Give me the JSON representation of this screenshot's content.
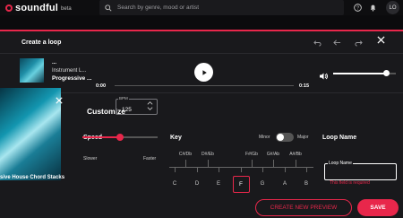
{
  "app": {
    "name": "soundful",
    "badge": "beta"
  },
  "search": {
    "placeholder": "Search by genre, mood or artist",
    "icon": "search-icon"
  },
  "user": {
    "initials": "LO"
  },
  "colors": {
    "accent": "#e8274b",
    "modal_bg": "#19191c",
    "page_bg": "#0b0b0d"
  },
  "modal": {
    "title": "Create a loop"
  },
  "player": {
    "title": "...",
    "subtitle": "Instrument L...",
    "track": "Progressive ...",
    "time_current": "0:00",
    "time_total": "0:15",
    "progress": 0.0,
    "volume": 0.85
  },
  "customize": {
    "title": "Customize",
    "loop_label": "sive House Chord Stacks",
    "speed": {
      "label": "Speed",
      "bpm_caption": "BPM",
      "bpm_value": "125",
      "slider_value": 0.5,
      "min_label": "Slower",
      "max_label": "Faster"
    },
    "key": {
      "label": "Key",
      "mode_minor": "Minor",
      "mode_major": "Major",
      "mode_selected": "Minor",
      "sharps": [
        "C#/Db",
        "D#/Eb",
        "F#/Gb",
        "G#/Ab",
        "A#/Bb"
      ],
      "naturals": [
        "C",
        "D",
        "E",
        "F",
        "G",
        "A",
        "B"
      ],
      "selected": "F"
    },
    "loop_name": {
      "label": "Loop Name",
      "caption": "Loop Name",
      "value": "",
      "error": "This field is required"
    }
  },
  "actions": {
    "preview": "CREATE NEW PREVIEW",
    "save": "SAVE"
  }
}
